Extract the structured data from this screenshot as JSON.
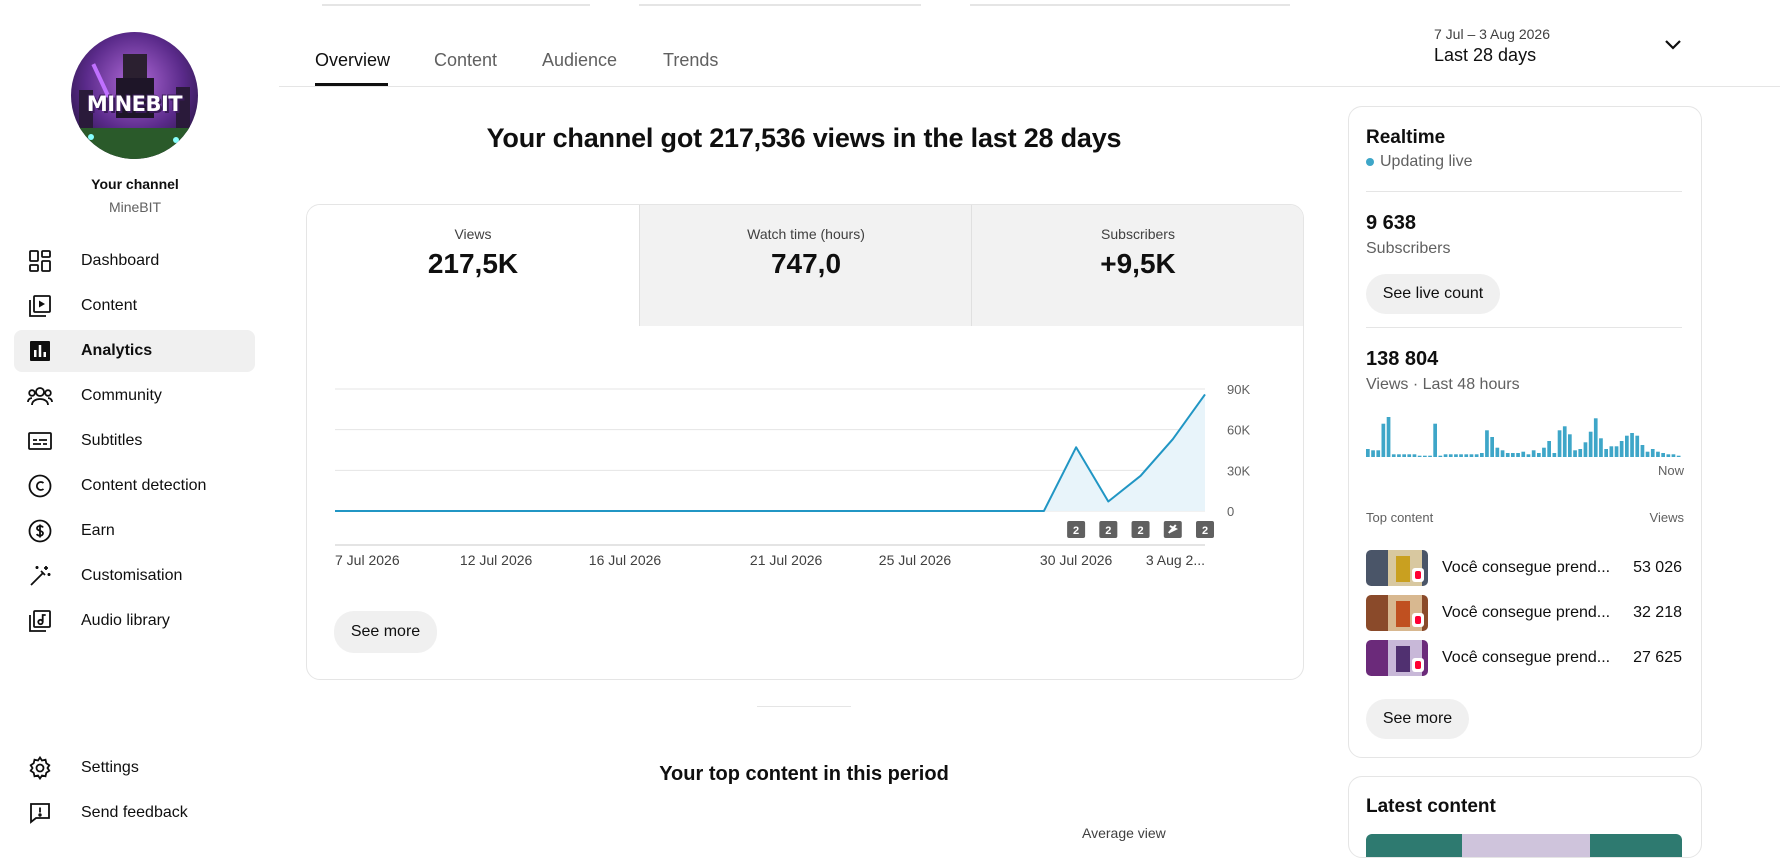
{
  "sidebar": {
    "channel_title": "Your channel",
    "channel_name": "MineBIT",
    "avatar_text": "MINEBIT",
    "items": [
      {
        "label": "Dashboard",
        "icon": "dashboard-icon"
      },
      {
        "label": "Content",
        "icon": "content-icon"
      },
      {
        "label": "Analytics",
        "icon": "analytics-icon",
        "active": true
      },
      {
        "label": "Community",
        "icon": "community-icon"
      },
      {
        "label": "Subtitles",
        "icon": "subtitles-icon"
      },
      {
        "label": "Content detection",
        "icon": "copyright-icon"
      },
      {
        "label": "Earn",
        "icon": "earn-icon"
      },
      {
        "label": "Customisation",
        "icon": "customisation-icon"
      },
      {
        "label": "Audio library",
        "icon": "audio-library-icon"
      }
    ],
    "bottom_items": [
      {
        "label": "Settings",
        "icon": "gear-icon"
      },
      {
        "label": "Send feedback",
        "icon": "feedback-icon"
      }
    ]
  },
  "tabs": [
    "Overview",
    "Content",
    "Audience",
    "Trends"
  ],
  "date_range": {
    "range": "7 Jul – 3 Aug 2026",
    "label": "Last 28 days"
  },
  "headline": "Your channel got 217,536 views in the last 28 days",
  "metrics": [
    {
      "label": "Views",
      "value": "217,5K"
    },
    {
      "label": "Watch time (hours)",
      "value": "747,0"
    },
    {
      "label": "Subscribers",
      "value": "+9,5K"
    }
  ],
  "chart_data": {
    "type": "area",
    "x_labels": [
      "7 Jul 2026",
      "12 Jul 2026",
      "16 Jul 2026",
      "21 Jul 2026",
      "25 Jul 2026",
      "30 Jul 2026",
      "3 Aug 2..."
    ],
    "y_ticks": [
      "90K",
      "60K",
      "30K",
      "0"
    ],
    "ylim": [
      0,
      90000
    ],
    "x": [
      "7 Jul",
      "8 Jul",
      "9 Jul",
      "10 Jul",
      "11 Jul",
      "12 Jul",
      "13 Jul",
      "14 Jul",
      "15 Jul",
      "16 Jul",
      "17 Jul",
      "18 Jul",
      "19 Jul",
      "20 Jul",
      "21 Jul",
      "22 Jul",
      "23 Jul",
      "24 Jul",
      "25 Jul",
      "26 Jul",
      "27 Jul",
      "28 Jul",
      "29 Jul",
      "30 Jul",
      "31 Jul",
      "1 Aug",
      "2 Aug",
      "3 Aug"
    ],
    "values": [
      0,
      0,
      0,
      0,
      0,
      0,
      0,
      0,
      0,
      0,
      0,
      0,
      0,
      0,
      0,
      0,
      0,
      0,
      0,
      0,
      0,
      0,
      0,
      47000,
      7000,
      26000,
      53000,
      86000
    ],
    "markers": [
      "2",
      "2",
      "2",
      "shorts",
      "2"
    ],
    "marker_x": [
      "30 Jul",
      "31 Jul",
      "1 Aug",
      "2 Aug",
      "3 Aug"
    ],
    "grid": true,
    "see_more": "See more"
  },
  "realtime": {
    "title": "Realtime",
    "status": "Updating live",
    "status_color": "#3ea6c8",
    "subscribers_value": "9 638",
    "subscribers_label": "Subscribers",
    "live_count_button": "See live count",
    "views_value": "138 804",
    "views_label": "Views · Last 48 hours",
    "now_label": "Now",
    "bars": [
      6,
      5,
      5,
      25,
      30,
      2,
      2,
      2,
      2,
      2,
      1,
      1,
      1,
      25,
      1,
      2,
      2,
      2,
      2,
      2,
      2,
      2,
      3,
      20,
      15,
      7,
      5,
      3,
      3,
      3,
      4,
      2,
      5,
      3,
      7,
      12,
      3,
      20,
      23,
      17,
      5,
      6,
      11,
      19,
      29,
      14,
      6,
      8,
      8,
      12,
      16,
      18,
      16,
      9,
      4,
      6,
      4,
      3,
      2,
      2,
      1
    ]
  },
  "top_content": {
    "header": "Top content",
    "views_header": "Views",
    "items": [
      {
        "title": "Você consegue prend...",
        "views": "53 026",
        "bg": "#4a5568"
      },
      {
        "title": "Você consegue prend...",
        "views": "32 218",
        "bg": "#8a4a2a"
      },
      {
        "title": "Você consegue prend...",
        "views": "27 625",
        "bg": "#6b2a7a"
      }
    ],
    "see_more": "See more"
  },
  "top_period": {
    "title": "Your top content in this period",
    "avg_view": "Average view"
  },
  "latest": {
    "title": "Latest content"
  }
}
